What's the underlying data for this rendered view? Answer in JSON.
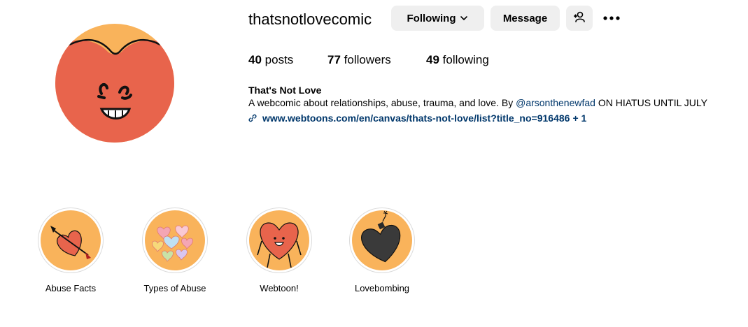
{
  "profile": {
    "username": "thatsnotlovecomic",
    "avatar_icon": "heart-character-avatar"
  },
  "actions": {
    "following_label": "Following",
    "message_label": "Message",
    "add_user_icon": "add-person-icon",
    "more_icon": "more-options-icon"
  },
  "stats": {
    "posts_count": "40",
    "posts_label": "posts",
    "followers_count": "77",
    "followers_label": "followers",
    "following_count": "49",
    "following_label": "following"
  },
  "bio": {
    "name": "That's Not Love",
    "text_before": "A webcomic about relationships, abuse, trauma, and love. By ",
    "mention": "@arsonthenewfad",
    "text_after": " ON HIATUS UNTIL JULY",
    "link": "www.webtoons.com/en/canvas/thats-not-love/list?title_no=916486",
    "link_extra": "+ 1"
  },
  "highlights": [
    {
      "label": "Abuse Facts",
      "icon": "arrow-heart-icon"
    },
    {
      "label": "Types of Abuse",
      "icon": "candy-hearts-icon"
    },
    {
      "label": "Webtoon!",
      "icon": "heart-character-icon"
    },
    {
      "label": "Lovebombing",
      "icon": "bomb-heart-icon"
    }
  ],
  "colors": {
    "avatar_bg": "#f9b35b",
    "heart": "#e8644c",
    "link": "#00376b",
    "button_bg": "#efefef"
  }
}
